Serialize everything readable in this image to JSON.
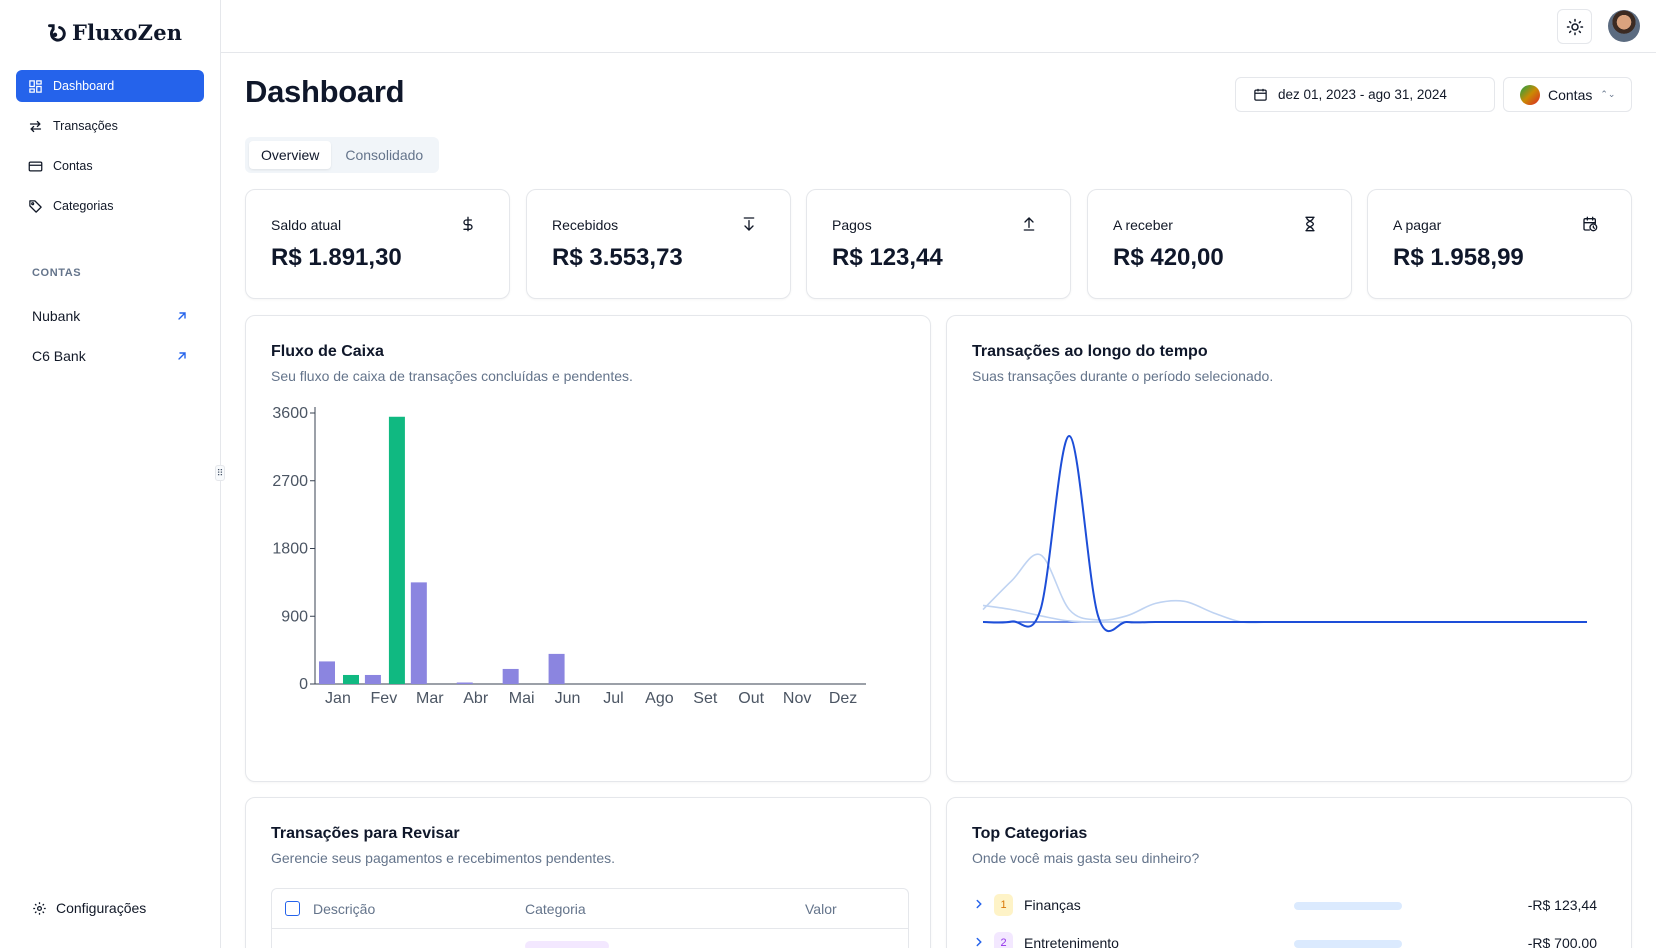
{
  "app": {
    "name": "FluxoZen"
  },
  "sidebar": {
    "nav": [
      {
        "label": "Dashboard",
        "icon": "grid-icon",
        "active": true
      },
      {
        "label": "Transações",
        "icon": "arrows-icon"
      },
      {
        "label": "Contas",
        "icon": "card-icon"
      },
      {
        "label": "Categorias",
        "icon": "tag-icon"
      }
    ],
    "accounts_label": "CONTAS",
    "accounts": [
      {
        "label": "Nubank",
        "icon": "arrow-up-right-icon"
      },
      {
        "label": "C6 Bank",
        "icon": "arrow-up-right-icon"
      }
    ],
    "settings_label": "Configurações",
    "handle_glyph": "⠿"
  },
  "header": {
    "title": "Dashboard",
    "date_range": "dez 01, 2023 - ago 31, 2024",
    "accounts_button": "Contas",
    "accounts_chevron": "⌃⌄"
  },
  "tabs": [
    {
      "label": "Overview",
      "active": true
    },
    {
      "label": "Consolidado",
      "active": false
    }
  ],
  "stats": [
    {
      "label": "Saldo atual",
      "value": "R$ 1.891,30",
      "icon": "dollar-icon"
    },
    {
      "label": "Recebidos",
      "value": "R$ 3.553,73",
      "icon": "arrow-down-icon"
    },
    {
      "label": "Pagos",
      "value": "R$ 123,44",
      "icon": "arrow-up-icon"
    },
    {
      "label": "A receber",
      "value": "R$ 420,00",
      "icon": "hourglass-icon"
    },
    {
      "label": "A pagar",
      "value": "R$ 1.958,99",
      "icon": "calendar-clock-icon"
    }
  ],
  "cashflow": {
    "title": "Fluxo de Caixa",
    "subtitle": "Seu fluxo de caixa de transações concluídas e pendentes."
  },
  "timeline": {
    "title": "Transações ao longo do tempo",
    "subtitle": "Suas transações durante o período selecionado."
  },
  "review": {
    "title": "Transações para Revisar",
    "subtitle": "Gerencie seus pagamentos e recebimentos pendentes.",
    "columns": [
      "Descrição",
      "Categoria",
      "Valor"
    ]
  },
  "top_categories": {
    "title": "Top Categorias",
    "subtitle": "Onde você mais gasta seu dinheiro?",
    "items": [
      {
        "rank": "1",
        "name": "Finanças",
        "value": "-R$ 123,44",
        "badge_bg": "#fef3c7",
        "badge_fg": "#d97706"
      },
      {
        "rank": "2",
        "name": "Entretenimento",
        "value": "-R$ 700,00",
        "badge_bg": "#f3e8ff",
        "badge_fg": "#9333ea"
      }
    ]
  },
  "colors": {
    "accent": "#2563eb",
    "bar_primary": "#8b85e0",
    "bar_secondary": "#10b981",
    "line_primary": "#1d4ed8",
    "line_secondary": "#bfd3f2"
  },
  "chart_data": [
    {
      "type": "bar",
      "categories": [
        "Jan",
        "Fev",
        "Mar",
        "Abr",
        "Mai",
        "Jun",
        "Jul",
        "Ago",
        "Set",
        "Out",
        "Nov",
        "Dez"
      ],
      "series": [
        {
          "values": [
            300,
            120,
            1350,
            20,
            200,
            400,
            0,
            0,
            0,
            0,
            0,
            0
          ]
        },
        {
          "values": [
            120,
            3550,
            0,
            0,
            0,
            0,
            0,
            0,
            0,
            0,
            0,
            0
          ]
        }
      ],
      "series_order": [
        [
          0,
          1
        ],
        [
          0,
          1
        ],
        [
          0
        ],
        [
          0
        ],
        [
          0
        ],
        [
          0
        ],
        [
          0
        ],
        [
          0
        ],
        [
          0
        ],
        [
          0
        ],
        [
          0
        ],
        [
          0
        ]
      ],
      "yticks": [
        0,
        900,
        1800,
        2700,
        3600
      ],
      "ylim": [
        0,
        3600
      ],
      "grid": false
    },
    {
      "type": "area",
      "series": [
        {
          "values": [
            0,
            5,
            120,
            1800,
            60,
            0,
            0,
            0,
            0,
            0,
            0,
            0,
            0,
            0,
            0,
            0,
            0,
            0,
            0,
            0,
            0,
            0
          ]
        },
        {
          "values": [
            120,
            400,
            650,
            120,
            20,
            60,
            180,
            200,
            90,
            0,
            0,
            0,
            0,
            0,
            0,
            0,
            0,
            0,
            0,
            0,
            0,
            0
          ]
        },
        {
          "values": [
            160,
            120,
            60,
            10,
            0,
            0,
            0,
            0,
            0,
            0,
            0,
            0,
            0,
            0,
            0,
            0,
            0,
            0,
            0,
            0,
            0,
            0
          ]
        }
      ],
      "grid": false
    }
  ]
}
